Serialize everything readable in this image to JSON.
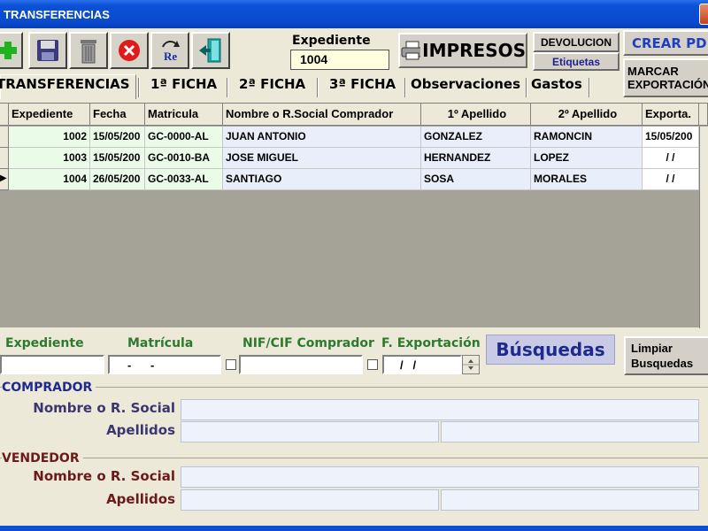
{
  "window": {
    "title": "TRANSFERENCIAS"
  },
  "toolbar": {
    "expediente_label": "Expediente",
    "expediente_value": "1004",
    "impresos_label": "IMPRESOS",
    "devolucion_label": "DEVOLUCION",
    "etiquetas_label": "Etiquetas",
    "crear_pdf_label": "CREAR PDF",
    "marcar_line1": "MARCAR",
    "marcar_line2": "EXPORTACIÓN",
    "icons": [
      "plus-icon",
      "save-icon",
      "trash-icon",
      "cancel-icon",
      "refresh-icon",
      "exit-door-icon",
      "printer-icon"
    ]
  },
  "tabs": [
    "TRANSFERENCIAS",
    "1ª FICHA",
    "2ª FICHA",
    "3ª FICHA",
    "Observaciones",
    "Gastos"
  ],
  "grid": {
    "columns": [
      "Expediente",
      "Fecha",
      "Matricula",
      "Nombre o R.Social Comprador",
      "1º Apellido",
      "2º Apellido",
      "Exporta."
    ],
    "rows": [
      [
        "1002",
        "15/05/200",
        "GC-0000-AL",
        "JUAN ANTONIO",
        "GONZALEZ",
        "RAMONCIN",
        "15/05/200"
      ],
      [
        "1003",
        "15/05/200",
        "GC-0010-BA",
        "JOSE MIGUEL",
        "HERNANDEZ",
        "LOPEZ",
        "/   /"
      ],
      [
        "1004",
        "26/05/200",
        "GC-0033-AL",
        "SANTIAGO",
        "SOSA",
        "MORALES",
        "/   /"
      ]
    ],
    "current_row_indicator": "▶"
  },
  "search": {
    "expediente_label": "Expediente",
    "matricula_label": "Matrícula",
    "nif_label": "NIF/CIF Comprador",
    "fexport_label": "F. Exportación",
    "matricula_mask": "-      -",
    "fexport_mask": "/   /",
    "busquedas_label": "Búsquedas",
    "limpiar_line1": "Limpiar",
    "limpiar_line2": "Busquedas"
  },
  "comprador": {
    "title": "COMPRADOR",
    "nombre_label": "Nombre o R. Social",
    "apellidos_label": "Apellidos"
  },
  "vendedor": {
    "title": "VENDEDOR",
    "nombre_label": "Nombre o R. Social",
    "apellidos_label": "Apellidos"
  },
  "colors": {
    "title_bar": "#0b50d6",
    "green_label": "#2d7a2d",
    "navy_text": "#1f1f8f",
    "grid_row": "#eafbe8",
    "grid_blue": "#e9eefb"
  }
}
